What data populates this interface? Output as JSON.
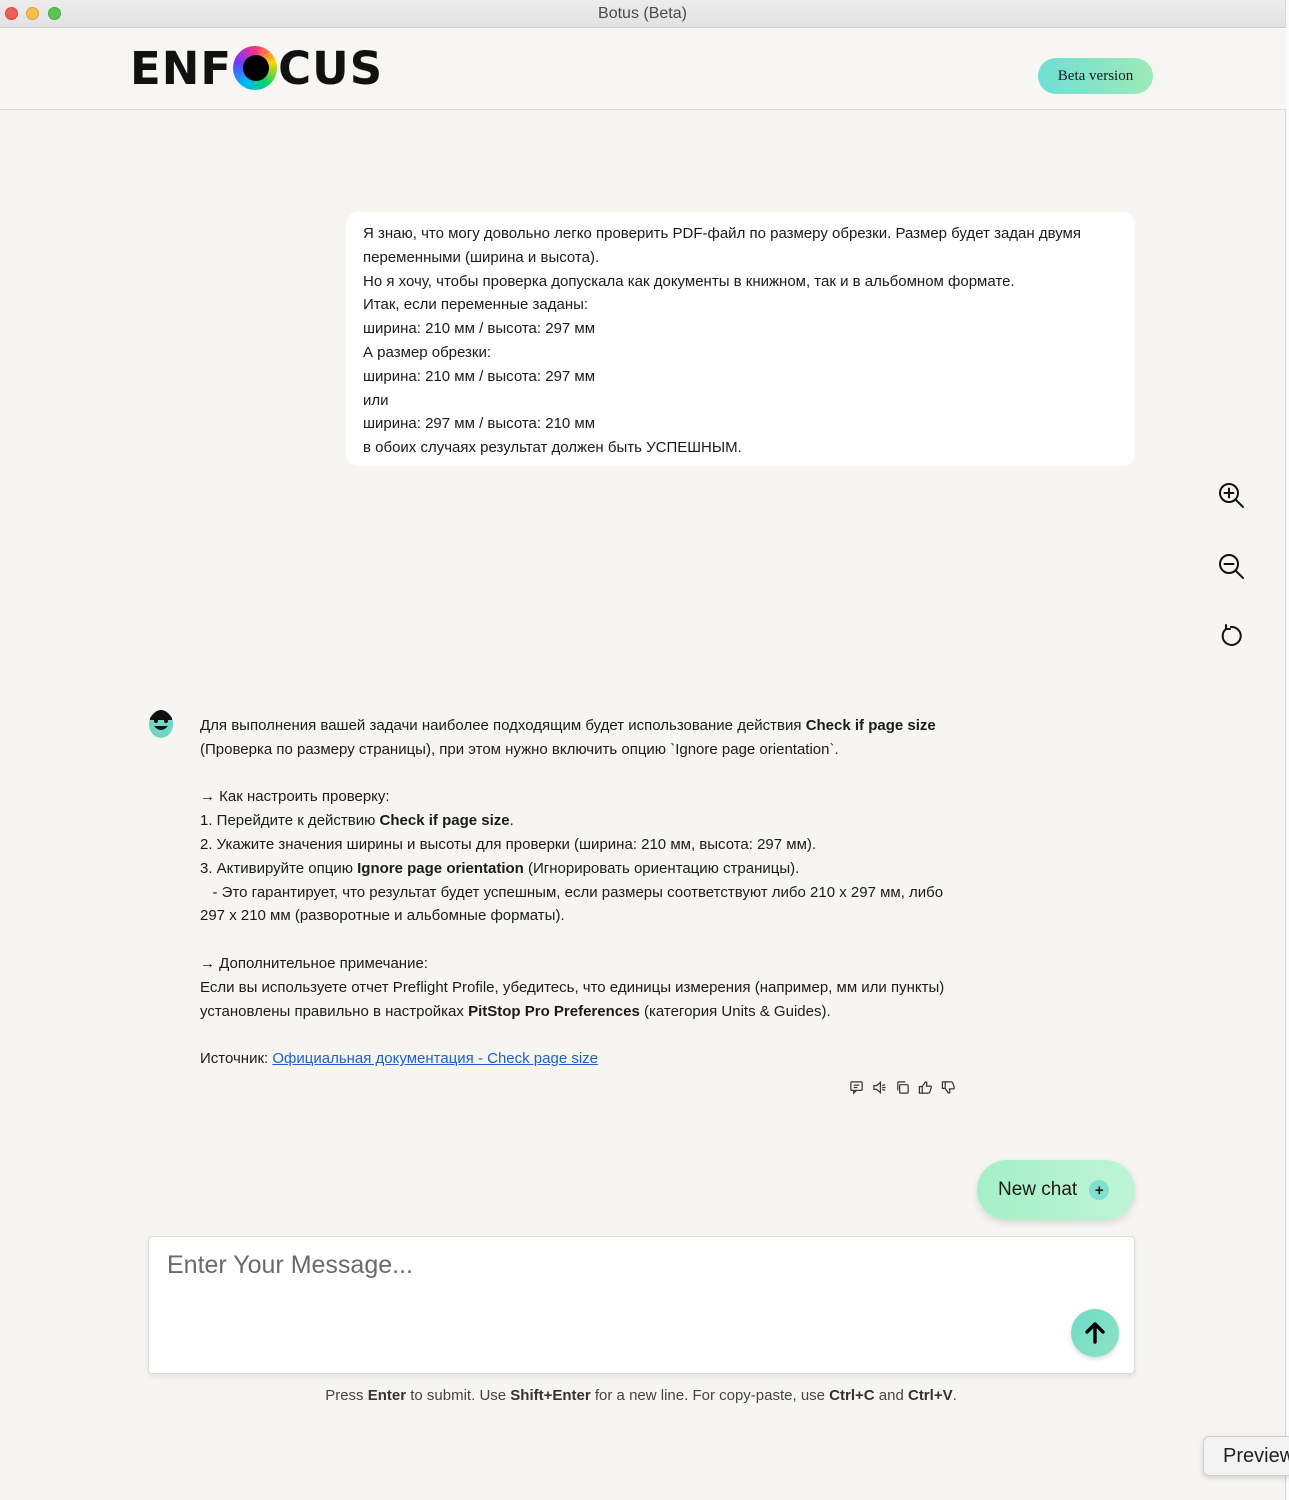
{
  "window": {
    "title": "Botus (Beta)"
  },
  "header": {
    "logo_left": "ENF",
    "logo_right": "CUS",
    "beta_label": "Beta version"
  },
  "user_message": {
    "lines": [
      "Я знаю, что могу довольно легко проверить PDF-файл по размеру обрезки. Размер будет задан двумя переменными (ширина и высота).",
      "Но я хочу, чтобы проверка допускала как документы в книжном, так и в альбомном формате.",
      "Итак, если переменные заданы:",
      "ширина: 210 мм / высота: 297 мм",
      "А размер обрезки:",
      "ширина: 210 мм / высота: 297 мм",
      "или",
      "ширина: 297 мм / высота: 210 мм",
      "в обоих случаях результат должен быть УСПЕШНЫМ."
    ]
  },
  "side_tools": {
    "zoom_in": "zoom-in-icon",
    "zoom_out": "zoom-out-icon",
    "reset": "reset-icon"
  },
  "bot_message": {
    "p1_a": "Для выполнения вашей задачи наиболее подходящим будет использование действия ",
    "p1_b": "Check if page size",
    "p1_c": " (Проверка по размеру страницы), при этом нужно включить опцию `Ignore page orientation`.",
    "h1": "→ Как настроить проверку:",
    "s1_a": "1. Перейдите к действию ",
    "s1_b": "Check if page size",
    "s1_c": ".",
    "s2": "2. Укажите значения ширины и высоты для проверки (ширина: 210 мм, высота: 297 мм).",
    "s3_a": "3. Активируйте опцию ",
    "s3_b": "Ignore page orientation",
    "s3_c": " (Игнорировать ориентацию страницы).",
    "s4": "   - Это гарантирует, что результат будет успешным, если размеры соответствуют либо 210 x 297 мм, либо 297 x 210 мм (разворотные и альбомные форматы).",
    "h2": "→ Дополнительное примечание:",
    "n_a": "Если вы используете отчет Preflight Profile, убедитесь, что единицы измерения (например, мм или пункты) установлены правильно в настройках ",
    "n_b": "PitStop Pro Preferences",
    "n_c": " (категория Units & Guides).",
    "src_label": "Источник: ",
    "src_link": "Официальная документация - Check page size"
  },
  "actions": [
    "comment-icon",
    "speaker-icon",
    "copy-icon",
    "thumbs-up-icon",
    "thumbs-down-icon"
  ],
  "new_chat": {
    "label": "New chat",
    "plus": "+"
  },
  "composer": {
    "placeholder": "Enter Your Message..."
  },
  "hint": {
    "t1": "Press ",
    "k1": "Enter",
    "t2": " to submit. Use ",
    "k2": "Shift+Enter",
    "t3": " for a new line. For copy-paste, use ",
    "k3": "Ctrl+C",
    "t4": " and ",
    "k4": "Ctrl+V",
    "t5": "."
  },
  "preview_tab": "Preview"
}
